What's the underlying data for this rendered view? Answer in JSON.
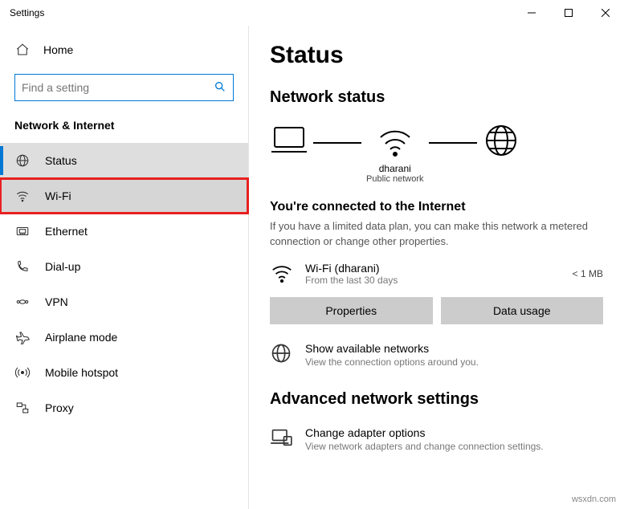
{
  "window": {
    "title": "Settings"
  },
  "sidebar": {
    "home_label": "Home",
    "search_placeholder": "Find a setting",
    "group_title": "Network & Internet",
    "items": [
      {
        "label": "Status"
      },
      {
        "label": "Wi-Fi"
      },
      {
        "label": "Ethernet"
      },
      {
        "label": "Dial-up"
      },
      {
        "label": "VPN"
      },
      {
        "label": "Airplane mode"
      },
      {
        "label": "Mobile hotspot"
      },
      {
        "label": "Proxy"
      }
    ]
  },
  "content": {
    "page_title": "Status",
    "section_title": "Network status",
    "diagram": {
      "network_name": "dharani",
      "network_type": "Public network"
    },
    "connected_heading": "You're connected to the Internet",
    "connected_desc": "If you have a limited data plan, you can make this network a metered connection or change other properties.",
    "connection": {
      "name": "Wi-Fi (dharani)",
      "sub": "From the last 30 days",
      "usage": "< 1 MB",
      "properties_btn": "Properties",
      "datausage_btn": "Data usage"
    },
    "show_networks": {
      "title": "Show available networks",
      "desc": "View the connection options around you."
    },
    "advanced_title": "Advanced network settings",
    "adapter": {
      "title": "Change adapter options",
      "desc": "View network adapters and change connection settings."
    }
  },
  "watermark": "wsxdn.com"
}
